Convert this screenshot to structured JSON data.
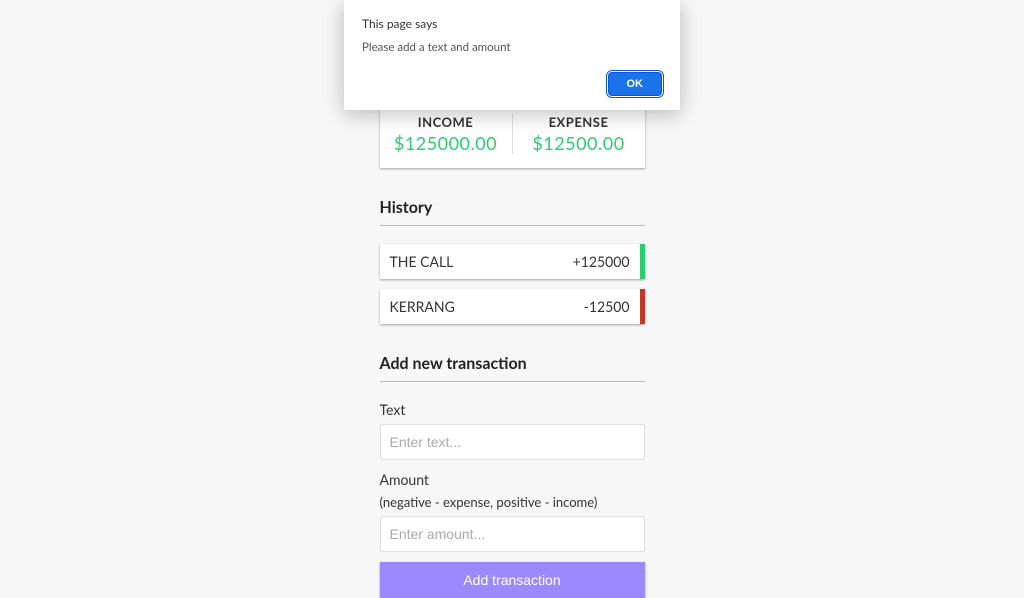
{
  "alert": {
    "title": "This page says",
    "message": "Please add a text and amount",
    "ok": "OK"
  },
  "summary": {
    "income_label": "INCOME",
    "income_value": "$125000.00",
    "expense_label": "EXPENSE",
    "expense_value": "$12500.00"
  },
  "history": {
    "heading": "History",
    "items": [
      {
        "text": "THE CALL",
        "amount": "+125000",
        "sign": "plus"
      },
      {
        "text": "KERRANG",
        "amount": "-12500",
        "sign": "minus"
      }
    ]
  },
  "form": {
    "heading": "Add new transaction",
    "text_label": "Text",
    "text_placeholder": "Enter text...",
    "amount_label": "Amount",
    "amount_hint": "(negative - expense, positive - income)",
    "amount_placeholder": "Enter amount...",
    "submit": "Add transaction"
  }
}
